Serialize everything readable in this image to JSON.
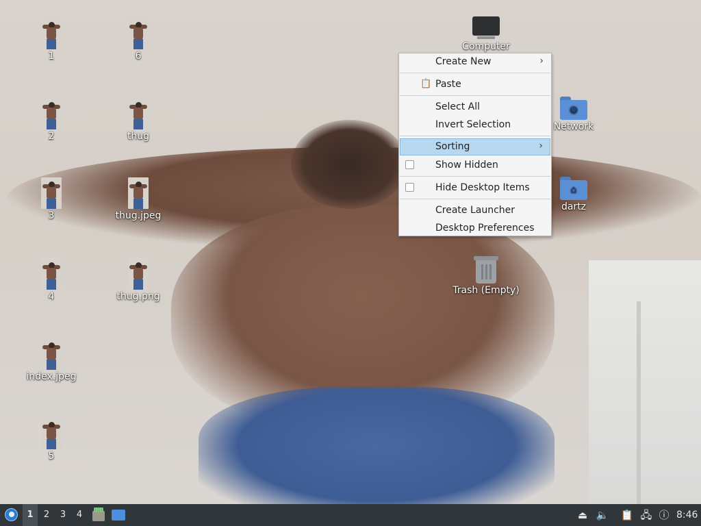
{
  "desktop": {
    "icons": [
      {
        "label": "1"
      },
      {
        "label": "2"
      },
      {
        "label": "3"
      },
      {
        "label": "4"
      },
      {
        "label": "index.jpeg"
      },
      {
        "label": "5"
      },
      {
        "label": "6"
      },
      {
        "label": "thug"
      },
      {
        "label": "thug.jpeg"
      },
      {
        "label": "thug.png"
      }
    ],
    "system_icons": {
      "computer": {
        "label": "Computer",
        "icon": "computer-icon"
      },
      "network": {
        "label": "Network",
        "icon": "network-folder-icon"
      },
      "home": {
        "label": "dartz",
        "icon": "home-folder-icon"
      },
      "trash": {
        "label": "Trash (Empty)",
        "icon": "trash-icon"
      }
    }
  },
  "context_menu": {
    "items": [
      {
        "label": "Create New",
        "submenu": true
      },
      {
        "label": "Paste",
        "icon": "paste-icon"
      },
      {
        "label": "Select All"
      },
      {
        "label": "Invert Selection"
      },
      {
        "label": "Sorting",
        "submenu": true,
        "highlighted": true
      },
      {
        "label": "Show Hidden",
        "checkbox": true,
        "checked": false
      },
      {
        "label": "Hide Desktop Items",
        "checkbox": true,
        "checked": false
      },
      {
        "label": "Create Launcher"
      },
      {
        "label": "Desktop Preferences"
      }
    ]
  },
  "taskbar": {
    "workspaces": [
      "1",
      "2",
      "3",
      "4"
    ],
    "active_workspace": "1",
    "clock": "8:46",
    "colors": {
      "panel": "#31363b",
      "menu_highlight": "#b8d8ef"
    }
  }
}
